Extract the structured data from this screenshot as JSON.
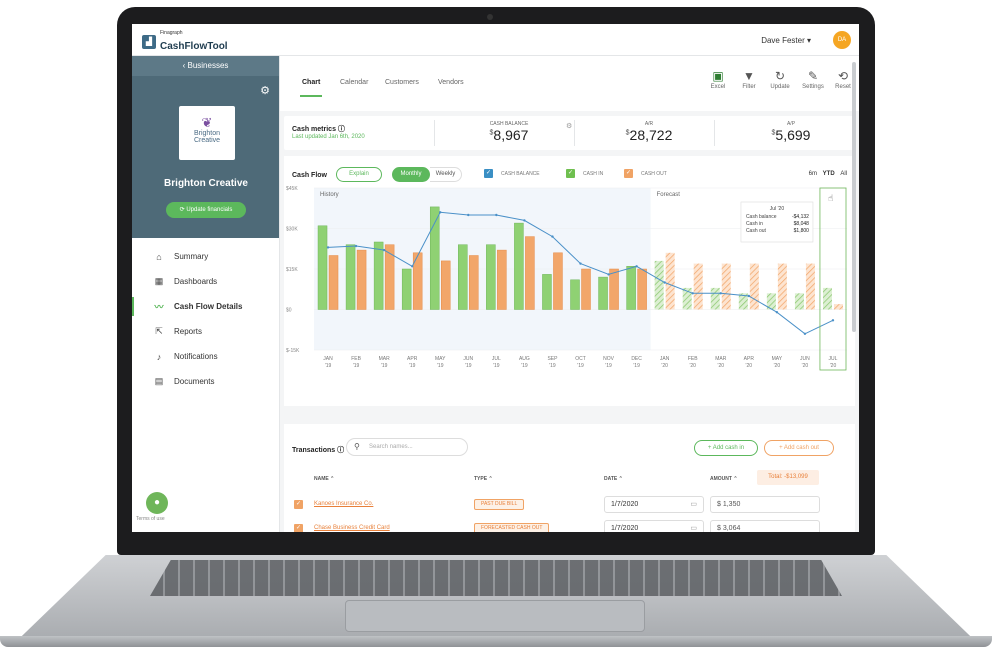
{
  "app": {
    "brand_small": "Finagraph",
    "brand_main": "CashFlowTool",
    "user_name": "Dave Fester ▾",
    "avatar_initials": "DA"
  },
  "sidebar": {
    "back_label": "‹ Businesses",
    "business_logo_line1": "Brighton",
    "business_logo_line2": "Creative",
    "business_name": "Brighton Creative",
    "update_button": "Update financials",
    "items": [
      {
        "label": "Summary",
        "icon": "home-icon"
      },
      {
        "label": "Dashboards",
        "icon": "dashboard-icon"
      },
      {
        "label": "Cash Flow Details",
        "icon": "trend-icon"
      },
      {
        "label": "Reports",
        "icon": "report-icon"
      },
      {
        "label": "Notifications",
        "icon": "bell-icon"
      },
      {
        "label": "Documents",
        "icon": "document-icon"
      }
    ],
    "terms": "Terms of use"
  },
  "tabs": [
    "Chart",
    "Calendar",
    "Customers",
    "Vendors"
  ],
  "toolbar": [
    "Excel",
    "Filter",
    "Update",
    "Settings",
    "Reset"
  ],
  "metrics": {
    "title": "Cash metrics ⓘ",
    "updated": "Last updated Jan 6th, 2020",
    "cash_balance_label": "CASH BALANCE",
    "cash_balance": "8,967",
    "ar_label": "A/R",
    "ar": "28,722",
    "ap_label": "A/P",
    "ap": "5,699",
    "currency": "$"
  },
  "cashflow": {
    "title": "Cash Flow",
    "explain": "Explain",
    "monthly": "Monthly",
    "weekly": "Weekly",
    "legend": [
      "CASH BALANCE",
      "CASH IN",
      "CASH OUT"
    ],
    "ranges": [
      "6m",
      "YTD",
      "All"
    ],
    "history_label": "History",
    "forecast_label": "Forecast"
  },
  "tooltip": {
    "title": "Jul '20",
    "rows": [
      [
        "Cash balance",
        "-$4,132"
      ],
      [
        "Cash in",
        "$8,048"
      ],
      [
        "Cash out",
        "$1,800"
      ]
    ]
  },
  "chart_data": {
    "type": "bar",
    "categories": [
      "JAN '19",
      "FEB '19",
      "MAR '19",
      "APR '19",
      "MAY '19",
      "JUN '19",
      "JUL '19",
      "AUG '19",
      "SEP '19",
      "OCT '19",
      "NOV '19",
      "DEC '19",
      "JAN '20",
      "FEB '20",
      "MAR '20",
      "APR '20",
      "MAY '20",
      "JUN '20",
      "JUL '20"
    ],
    "ylim": [
      -15000,
      45000
    ],
    "yticks": [
      "$45K",
      "$30K",
      "$15K",
      "$0",
      "$-15K"
    ],
    "series": [
      {
        "name": "CASH IN",
        "values": [
          31000,
          24000,
          25000,
          15000,
          38000,
          24000,
          24000,
          32000,
          13000,
          11000,
          12000,
          16000,
          18000,
          8000,
          8000,
          6000,
          6000,
          6000,
          8000
        ]
      },
      {
        "name": "CASH OUT",
        "values": [
          20000,
          22000,
          24000,
          21000,
          18000,
          20000,
          22000,
          27000,
          21000,
          15000,
          15000,
          15000,
          21000,
          17000,
          17000,
          17000,
          17000,
          17000,
          2000
        ]
      },
      {
        "name": "CASH BALANCE",
        "values": [
          23000,
          23500,
          22000,
          16000,
          36000,
          35000,
          35000,
          33000,
          27000,
          17000,
          13000,
          16000,
          10000,
          6000,
          6000,
          5000,
          -1000,
          -9000,
          -4000
        ]
      }
    ],
    "history_count": 12
  },
  "transactions": {
    "title": "Transactions ⓘ",
    "search_placeholder": "Search names...",
    "add_in": "+ Add cash in",
    "add_out": "+ Add cash out",
    "headers": [
      "NAME ⌃",
      "TYPE ⌃",
      "DATE ⌃",
      "AMOUNT ⌃"
    ],
    "total": "Total: -$13,099",
    "rows": [
      {
        "name": "Kanoes Insurance Co.",
        "type": "PAST DUE BILL",
        "date": "1/7/2020",
        "amount": "$ 1,350"
      },
      {
        "name": "Chase Business Credit Card",
        "type": "FORECASTED CASH OUT",
        "date": "1/7/2020",
        "amount": "$ 3,064"
      }
    ]
  }
}
